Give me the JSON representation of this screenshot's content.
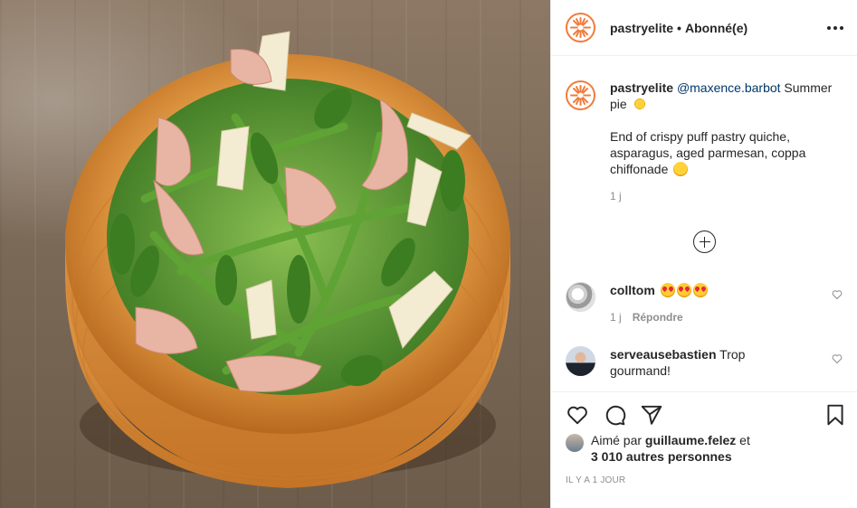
{
  "post": {
    "image_alt_subject": "",
    "author": {
      "username": "pastryelite",
      "separator": "•",
      "follow_status": "Abonné(e)"
    },
    "caption": {
      "username": "pastryelite",
      "mention": "@maxence.barbot",
      "line1_text": " Summer pie",
      "line1_emoji": "sun-emoji",
      "paragraph2": "End of crispy puff pastry quiche, asparagus, aged parmesan, coppa chiffonade",
      "paragraph2_emoji": "yum-emoji",
      "time": "1 j"
    },
    "load_more_icon": "plus-circle-icon",
    "comments": [
      {
        "username": "colltom",
        "text": "",
        "emojis": [
          "heart-eyes-emoji",
          "heart-eyes-emoji",
          "heart-eyes-emoji"
        ],
        "time": "1 j",
        "reply_label": "Répondre"
      },
      {
        "username": "serveausebastien",
        "text": " Trop gourmand!"
      }
    ],
    "actions": {
      "like": "heart-icon",
      "comment": "comment-bubble-icon",
      "share": "paper-plane-icon",
      "save": "bookmark-icon"
    },
    "likes": {
      "prefix": "Aimé par ",
      "user": "guillaume.felez",
      "middle": " et",
      "others": "3 010 autres personnes"
    },
    "timestamp": "IL Y A 1 JOUR"
  },
  "colors": {
    "brand_orange": "#f07c3c",
    "mention": "#00376b",
    "muted": "#8e8e8e",
    "text": "#262626"
  }
}
